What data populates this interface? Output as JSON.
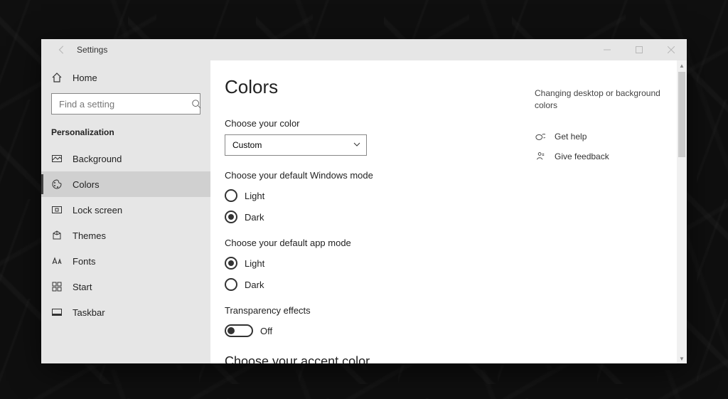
{
  "window": {
    "title": "Settings"
  },
  "sidebar": {
    "home": "Home",
    "search_placeholder": "Find a setting",
    "category": "Personalization",
    "items": [
      {
        "label": "Background"
      },
      {
        "label": "Colors"
      },
      {
        "label": "Lock screen"
      },
      {
        "label": "Themes"
      },
      {
        "label": "Fonts"
      },
      {
        "label": "Start"
      },
      {
        "label": "Taskbar"
      }
    ]
  },
  "page": {
    "title": "Colors",
    "choose_color_label": "Choose your color",
    "choose_color_value": "Custom",
    "windows_mode_label": "Choose your default Windows mode",
    "windows_mode_options": {
      "light": "Light",
      "dark": "Dark"
    },
    "windows_mode_selected": "dark",
    "app_mode_label": "Choose your default app mode",
    "app_mode_options": {
      "light": "Light",
      "dark": "Dark"
    },
    "app_mode_selected": "light",
    "transparency_label": "Transparency effects",
    "transparency_value": "Off",
    "accent_heading": "Choose your accent color"
  },
  "right": {
    "tip": "Changing desktop or background colors",
    "help": "Get help",
    "feedback": "Give feedback"
  }
}
